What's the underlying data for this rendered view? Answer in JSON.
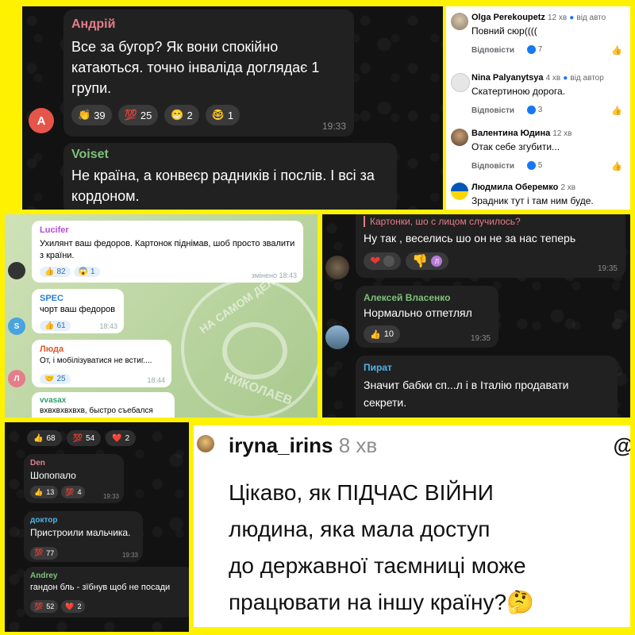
{
  "panel1": {
    "msg1": {
      "avatar_letter": "А",
      "author": "Андрій",
      "text": "Все за бугор? Як вони спокійно катаються. точно інваліда доглядає 1 групи.",
      "reactions": [
        {
          "icon": "👏",
          "count": "39"
        },
        {
          "icon": "💯",
          "count": "25"
        },
        {
          "icon": "😁",
          "count": "2"
        },
        {
          "icon": "🤓",
          "count": "1"
        }
      ],
      "time": "19:33"
    },
    "msg2": {
      "author": "Voiset",
      "text": "Не країна, а конвеєр радників і послів. І всі за кордоном."
    }
  },
  "panel2": {
    "comments": [
      {
        "name": "Olga Perekoupetz",
        "meta": "12 хв",
        "badge": "від авто",
        "text": "Повний сюр((((",
        "reply": "Відповісти",
        "reaction_count": "7"
      },
      {
        "name": "Nina Palyanytsya",
        "meta": "4 хв",
        "badge": "від автор",
        "text": "Скатертиною дорога.",
        "reply": "Відповісти",
        "reaction_count": "3"
      },
      {
        "name": "Валентина Юдина",
        "meta": "12 хв",
        "badge": "",
        "text": "Отак себе згубити...",
        "reply": "Відповісти",
        "reaction_count": "5"
      },
      {
        "name": "Людмила Оберемко",
        "meta": "2 хв",
        "badge": "",
        "text": "Зрадник тут і там ним буде.",
        "reply": "",
        "reaction_count": ""
      }
    ]
  },
  "panel3": {
    "watermark_top": "НА САМОМ ДЕЛЕ",
    "watermark_bottom": "НИКОЛАЕВ",
    "msgs": [
      {
        "author": "Lucifer",
        "text": "Ухилянт ваш федоров. Картонок піднімав, шоб просто звалити з країни.",
        "reactions": [
          {
            "icon": "👍",
            "count": "82"
          },
          {
            "icon": "😱",
            "count": "1"
          }
        ],
        "time": "змінено 18:43"
      },
      {
        "author": "SPEC",
        "avatar_letter": "S",
        "text": "чорт ваш федоров",
        "reactions": [
          {
            "icon": "👍",
            "count": "61"
          }
        ],
        "time": "18:43"
      },
      {
        "author": "Люда",
        "avatar_letter": "Л",
        "text": "От, і мобілізуватися не встиг....",
        "reactions": [
          {
            "icon": "🤝",
            "count": "25"
          }
        ],
        "time": "18:44"
      },
      {
        "author": "vvasax",
        "text": "вхвхвхвхвхв, быстро съебался"
      }
    ]
  },
  "panel4": {
    "quote": "Картонки, шо с лицом случилось?",
    "msg1_text": "Ну так , веселись шо он не за нас теперь",
    "msg1_time": "19:35",
    "msg1_chip": "Л",
    "msg2_author": "Алексей Власенко",
    "msg2_text": "Нормально отпетлял",
    "msg2_reaction": {
      "icon": "👍",
      "count": "10"
    },
    "msg2_time": "19:35",
    "msg3_author": "Пират",
    "msg3_text": "Значит бабки сп...л і в Італію продавати секрети."
  },
  "panel5": {
    "top_reactions": [
      {
        "icon": "👍",
        "count": "68"
      },
      {
        "icon": "💯",
        "count": "54"
      },
      {
        "icon": "❤️",
        "count": "2"
      }
    ],
    "msgs": [
      {
        "author": "Den",
        "text": "Шопопало",
        "reactions": [
          {
            "icon": "👍",
            "count": "13"
          },
          {
            "icon": "💯",
            "count": "4"
          }
        ],
        "time": "19:33"
      },
      {
        "author": "доктор",
        "text": "Пристроили мальчика.",
        "reactions": [
          {
            "icon": "💯",
            "count": "77"
          }
        ],
        "time": "19:33"
      },
      {
        "author": "Andrey",
        "text": "гандон бль - зїбнув щоб не посади",
        "reactions": [
          {
            "icon": "💯",
            "count": "52"
          },
          {
            "icon": "❤️",
            "count": "2"
          }
        ]
      }
    ]
  },
  "panel6": {
    "username": "iryna_irins",
    "time": "8 хв",
    "text_line1": "Цікаво, як ПІДЧАС ВІЙНИ",
    "text_line2": "людина, яка мала доступ",
    "text_line3": "до державної таємниці може",
    "text_line4": "працювати на іншу країну?🤔",
    "corner_symbol": "@"
  },
  "colors": {
    "background": "#fff200",
    "tg_dark_bubble": "#212121",
    "fb_blue": "#1877f2",
    "tg_name_pink": "#e57d8a",
    "tg_name_green": "#7fc27a"
  }
}
